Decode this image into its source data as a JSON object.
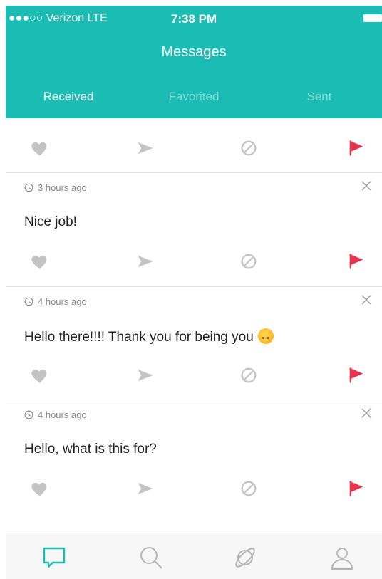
{
  "status_bar": {
    "carrier": "●●●○○ Verizon  LTE",
    "time": "7:38 PM"
  },
  "header": {
    "title": "Messages"
  },
  "tabs": [
    {
      "label": "Received",
      "active": true
    },
    {
      "label": "Favorited",
      "active": false
    },
    {
      "label": "Sent",
      "active": false
    }
  ],
  "messages": [
    {
      "time": "3 hours ago",
      "text": "Nice job!"
    },
    {
      "time": "4 hours ago",
      "text": "Hello there!!!! Thank you for being you",
      "emoji": "upside-down-face"
    },
    {
      "time": "4 hours ago",
      "text": "Hello, what is this for?"
    }
  ],
  "icons": {
    "like": "heart-icon",
    "forward": "send-icon",
    "block": "block-icon",
    "report": "flag-icon",
    "dismiss": "close-icon",
    "timestamp": "clock-icon"
  },
  "tabbar": [
    "messages-icon",
    "search-icon",
    "explore-icon",
    "profile-icon"
  ],
  "colors": {
    "accent": "#1bbcb3",
    "flag": "#e8334a",
    "icon_gray": "#c4c4c4"
  }
}
